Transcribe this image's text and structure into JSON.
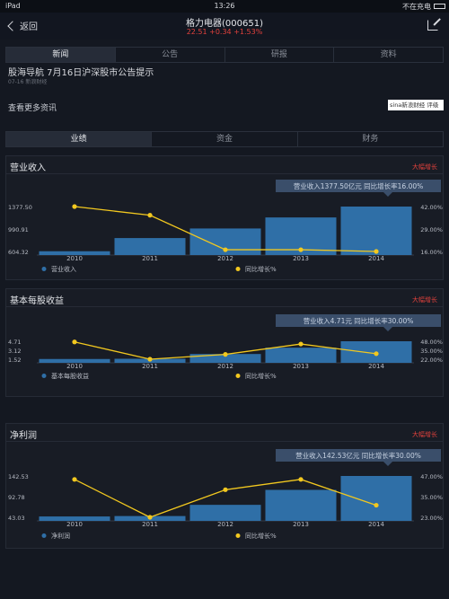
{
  "status_bar": {
    "device": "iPad",
    "time": "13:26",
    "charging": "不在充电"
  },
  "nav": {
    "back_label": "返回",
    "stock_name": "格力电器(000651)",
    "quote": "22.51  +0.34  +1.53%"
  },
  "tabs_primary": [
    "新闻",
    "公告",
    "研报",
    "资料"
  ],
  "news": {
    "title": "股海导航 7月16日沪深股市公告提示",
    "meta": "07-16 新浪财经"
  },
  "more_info": {
    "label": "查看更多资讯",
    "logo_text": "sina新浪财经 评级"
  },
  "tabs_secondary": [
    "业绩",
    "资金",
    "财务"
  ],
  "colors": {
    "bar": "#2f6fa7",
    "line": "#f2c81f",
    "accent_red": "#e0413c",
    "background": "#141821"
  },
  "chart_data": [
    {
      "type": "bar",
      "title": "营业收入",
      "link": "大幅增长",
      "tooltip": "营业收入1377.50亿元  同比增长率16.00%",
      "categories": [
        "2010",
        "2011",
        "2012",
        "2013",
        "2014"
      ],
      "y_ticks": [
        "1377.50",
        "990.91",
        "604.32"
      ],
      "y2_ticks": [
        "42.00%",
        "29.00%",
        "16.00%"
      ],
      "ylim": [
        604.32,
        1377.5
      ],
      "y2lim": [
        16,
        42
      ],
      "series": [
        {
          "name": "营业收入",
          "kind": "bar",
          "values": [
            608,
            835,
            1000,
            1190,
            1377.5
          ]
        },
        {
          "name": "同比增长%",
          "kind": "line",
          "values": [
            42,
            37,
            17,
            17,
            16
          ]
        }
      ]
    },
    {
      "type": "bar",
      "title": "基本每股收益",
      "link": "大幅增长",
      "tooltip": "营业收入4.71元  同比增长率30.00%",
      "categories": [
        "2010",
        "2011",
        "2012",
        "2013",
        "2014"
      ],
      "y_ticks": [
        "4.71",
        "3.12",
        "1.52"
      ],
      "y2_ticks": [
        "48.00%",
        "35.00%",
        "22.00%"
      ],
      "ylim": [
        1.52,
        4.71
      ],
      "y2lim": [
        22,
        48
      ],
      "series": [
        {
          "name": "基本每股收益",
          "kind": "bar",
          "values": [
            1.56,
            1.6,
            2.45,
            3.57,
            4.71
          ]
        },
        {
          "name": "同比增长%",
          "kind": "line",
          "values": [
            47,
            22,
            29,
            44,
            30
          ]
        }
      ]
    },
    {
      "type": "bar",
      "title": "净利润",
      "link": "大幅增长",
      "tooltip": "营业收入142.53亿元  同比增长率30.00%",
      "categories": [
        "2010",
        "2011",
        "2012",
        "2013",
        "2014"
      ],
      "y_ticks": [
        "142.53",
        "92.78",
        "43.03"
      ],
      "y2_ticks": [
        "47.00%",
        "35.00%",
        "23.00%"
      ],
      "ylim": [
        43.03,
        142.53
      ],
      "y2lim": [
        23,
        47
      ],
      "series": [
        {
          "name": "净利润",
          "kind": "bar",
          "values": [
            45,
            46,
            73,
            109,
            142.53
          ]
        },
        {
          "name": "同比增长%",
          "kind": "line",
          "values": [
            45,
            23,
            39,
            45,
            30
          ]
        }
      ]
    }
  ]
}
